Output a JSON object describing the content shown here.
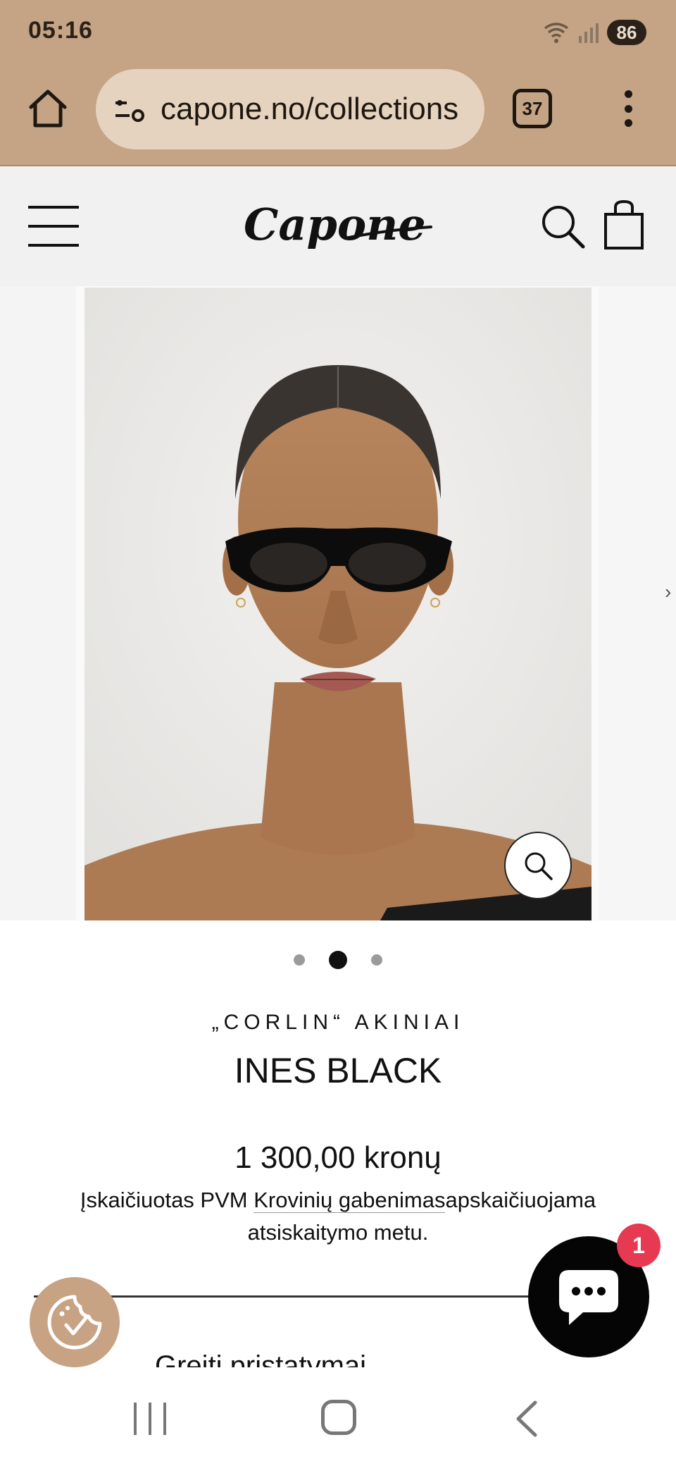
{
  "status_bar": {
    "time": "05:16",
    "battery": "86",
    "icons": [
      "wifi-icon",
      "signal-icon"
    ]
  },
  "browser": {
    "url": "capone.no/collections",
    "tab_count": "37",
    "icons": [
      "home-icon",
      "site-settings-icon",
      "more-vert-icon"
    ]
  },
  "site_header": {
    "logo_text": "Capone",
    "icons": [
      "menu-icon",
      "search-icon",
      "shopping-bag-icon"
    ]
  },
  "gallery": {
    "slide_count": 3,
    "active_slide": 2,
    "icons": [
      "zoom-icon"
    ]
  },
  "product": {
    "type_label": "„CORLIN“ AKINIAI",
    "name": "INES BLACK",
    "price": "1 300,00 kronų",
    "tax_note_prefix": "Įskaičiuotas PVM ",
    "tax_note_link": "Krovinių gabenimas",
    "tax_note_suffix": "apskaičiuojama atsiskaitymo metu.",
    "clipped_row_text": "Greiti pristatymai"
  },
  "widgets": {
    "chat_badge": "1",
    "icons": [
      "cookie-consent-icon",
      "chat-icon"
    ]
  },
  "colors": {
    "browser_chrome": "#c4a485",
    "header_bg": "#f1f1f1",
    "chat_badge": "#e63952",
    "cookie_button": "#c7a283"
  }
}
